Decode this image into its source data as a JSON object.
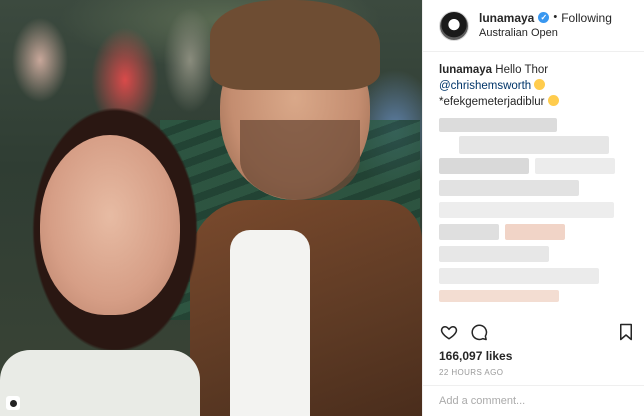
{
  "post": {
    "username": "lunamaya",
    "verified_symbol": "✓",
    "separator": "•",
    "follow_status": "Following",
    "location": "Australian Open",
    "caption": {
      "username": "lunamaya",
      "text_before": "Hello Thor",
      "mention": "@chrishemsworth",
      "line2": "*efekgemeterjadiblur"
    },
    "likes": "166,097 likes",
    "timestamp": "22 HOURS AGO",
    "comment_placeholder": "Add a comment..."
  },
  "icons": {
    "like": "heart-icon",
    "comment": "comment-icon",
    "save": "bookmark-icon",
    "verified": "verified-badge-icon"
  },
  "colors": {
    "verified_blue": "#3897f0",
    "mention": "#003569",
    "muted": "#999999"
  }
}
